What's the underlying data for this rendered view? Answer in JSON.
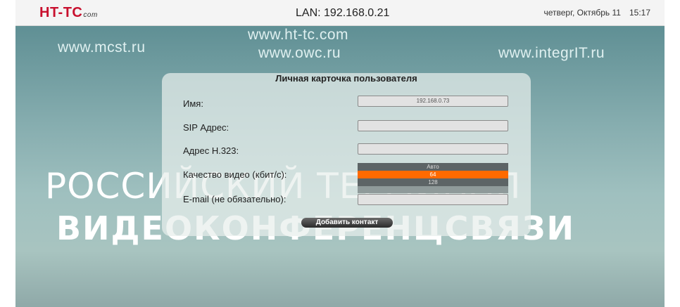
{
  "topbar": {
    "logo": "HT-TC",
    "logo_sub": "com",
    "lan": "LAN: 192.168.0.21",
    "date": "четверг, Октябрь 11",
    "time": "15:17"
  },
  "wallpaper": {
    "url_left": "www.mcst.ru",
    "url_center_1": "www.ht-tc.com",
    "url_center_2": "www.owc.ru",
    "url_right": "www.integrIT.ru",
    "line1": "РОССИЙСКИЙ ТЕРМИНАЛ",
    "line2": "ВИДЕОКОНФЕРЕНЦСВЯЗИ"
  },
  "dialog": {
    "title": "Личная карточка пользователя",
    "name_label": "Имя:",
    "name_value": "192.168.0.73",
    "sip_label": "SIP Адрес:",
    "sip_value": "",
    "h323_label": "Адрес H.323:",
    "h323_value": "",
    "quality_label": "Качество видео (кбит/с):",
    "quality_options": [
      "Авто",
      "64",
      "128",
      ""
    ],
    "quality_selected": "64",
    "email_label": "E-mail (не обязательно):",
    "email_value": "",
    "add_button": "Добавить контакт"
  },
  "colors": {
    "accent_selected": "#ff6a00",
    "logo_red": "#c8102e"
  }
}
